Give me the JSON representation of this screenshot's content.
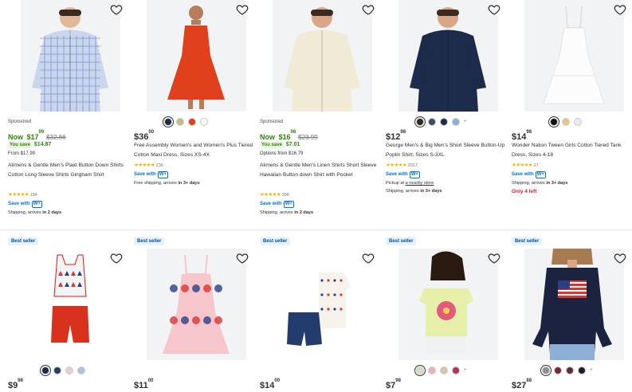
{
  "products_row1": [
    {
      "sponsored": "Sponsored",
      "now": "Now",
      "price_dollar": "$17",
      "price_cents": "99",
      "was": "$32.86",
      "you_save_label": "You save",
      "you_save_amount": "$14.87",
      "from_text": "From $17.99",
      "title": "Alimens & Gentle Men's Plaid Button Down Shirts Cotton Long Sleeve Shirts Gingham Shirt",
      "rating_count": "184",
      "save_with": "Save with",
      "wplus": "W+",
      "shipping_pre": "Shipping, arrives ",
      "shipping_bold": "in 2 days"
    },
    {
      "price_dollar": "$36",
      "price_cents": "00",
      "title": "Free Assembly Women's and Women's Plus Tiered Cotton Maxi Dress, Sizes XS-4X",
      "rating_count": "236",
      "save_with": "Save with",
      "wplus": "W+",
      "shipping_pre": "Free shipping, arrives ",
      "shipping_bold": "in 3+ days",
      "swatches": [
        "#1f2a44",
        "#c2c07a",
        "#e0401c",
        "#f6f6f6"
      ]
    },
    {
      "sponsored": "Sponsored",
      "now": "Now",
      "price_dollar": "$16",
      "price_cents": "98",
      "was": "$23.99",
      "you_save_label": "You save",
      "you_save_amount": "$7.01",
      "from_text": "Options from $16.79",
      "title": "Alimens & Gentle Men's Linen Shirts Short Sleeve Hawaiian Button down Shirt with Pocket",
      "rating_count": "398",
      "save_with": "Save with",
      "wplus": "W+",
      "shipping_pre": "Shipping, arrives ",
      "shipping_bold": "in 2 days"
    },
    {
      "price_dollar": "$12",
      "price_cents": "98",
      "title": "George Men's & Big Men's Short Sleeve Button-Up Poplin Shirt, Sizes S-3XL",
      "rating_count": "2017",
      "save_with": "Save with",
      "wplus": "W+",
      "pickup_pre": "Pickup at ",
      "pickup_link": "a nearby store",
      "shipping_pre": "Shipping, arrives ",
      "shipping_bold": "in 3+ days",
      "swatches": [
        "#2b2b2b",
        "#3e4f63",
        "#1d2b4a",
        "#8fb0d6"
      ],
      "more": "+"
    },
    {
      "price_dollar": "$14",
      "price_cents": "98",
      "title": "Wonder Nation Tween Girls Cotton Tiered Tank Dress, Sizes 4-18",
      "rating_count": "27",
      "save_with": "Save with",
      "wplus": "W+",
      "shipping_pre": "Shipping, arrives ",
      "shipping_bold": "in 3+ days",
      "only_left": "Only 4 left",
      "swatches": [
        "#111111",
        "#e6c98a",
        "#e9ecf5"
      ]
    }
  ],
  "products_row2": [
    {
      "badge": "Best seller",
      "price_dollar": "$9",
      "price_cents": "98",
      "swatches": [
        "#1d2b4a",
        "#2a3c66",
        "#e9d0d6",
        "#a9c4de"
      ]
    },
    {
      "badge": "Best seller",
      "price_dollar": "$11",
      "price_cents": "00"
    },
    {
      "badge": "Best seller",
      "price_dollar": "$14",
      "price_cents": "00"
    },
    {
      "badge": "Best seller",
      "price_dollar": "$7",
      "price_cents": "98",
      "swatches": [
        "#d9dbc0",
        "#e8b4b4",
        "#d8c8a8",
        "#b2335a"
      ],
      "more": "+"
    },
    {
      "badge": "Best seller",
      "price_dollar": "$27",
      "price_cents": "88",
      "swatches": [
        "#8c8f96",
        "#7a2a32",
        "#5b2c3e",
        "#1c1f33"
      ],
      "more": "+"
    }
  ]
}
